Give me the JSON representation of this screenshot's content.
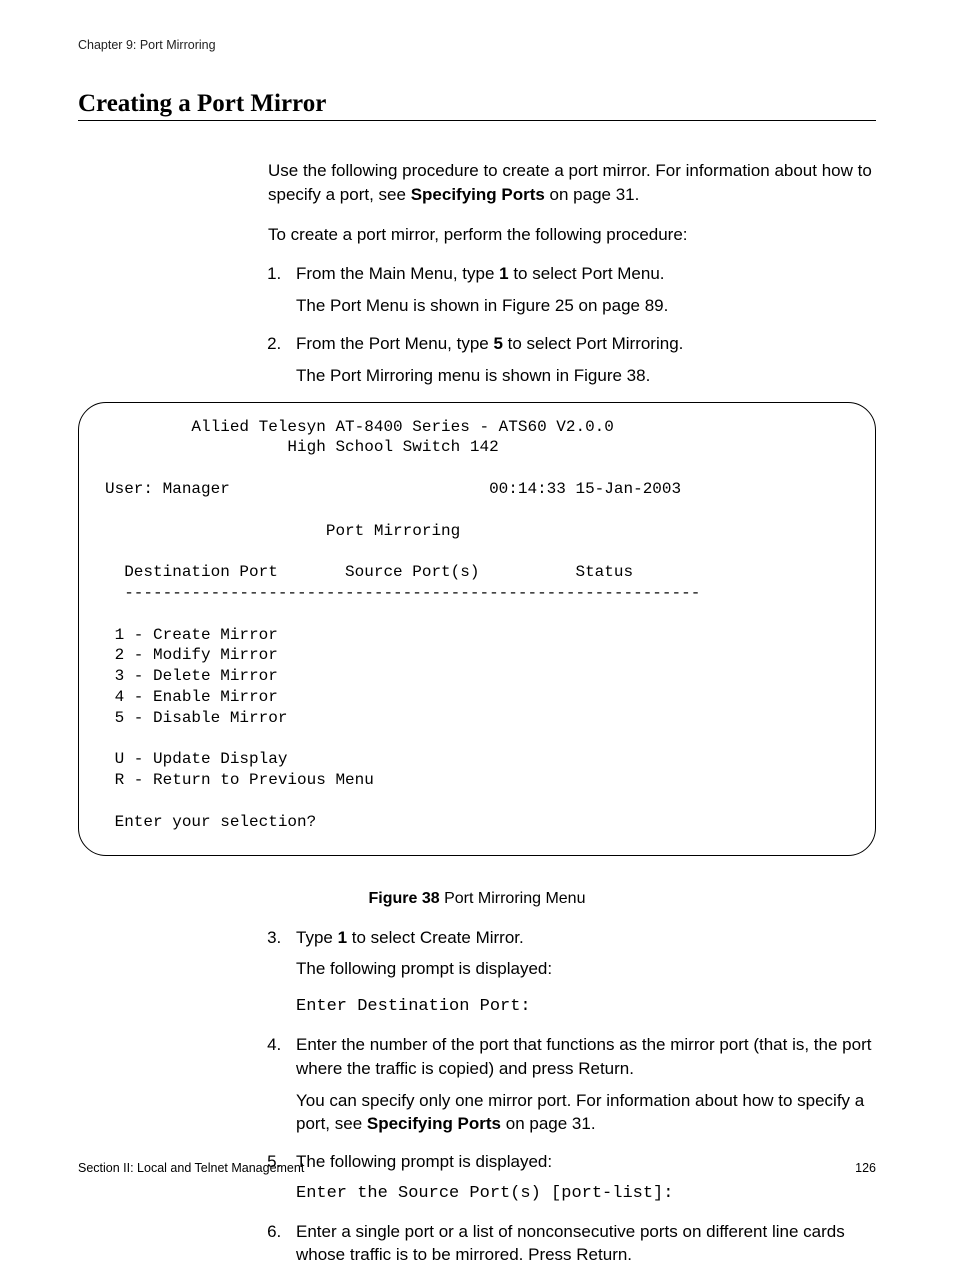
{
  "header": {
    "chapter": "Chapter 9: Port Mirroring"
  },
  "title": "Creating a Port Mirror",
  "intro1a": "Use the following procedure to create a port mirror. For information about how to specify a port, see ",
  "intro1b": "Specifying Ports",
  "intro1c": " on page 31.",
  "intro2": "To create a port mirror, perform the following procedure:",
  "step1a": "From the Main Menu, type ",
  "step1b": "1",
  "step1c": " to select Port Menu.",
  "step1sub": "The Port Menu is shown in Figure 25 on page 89.",
  "step2a": "From the Port Menu, type ",
  "step2b": "5",
  "step2c": " to select Port Mirroring.",
  "step2sub": "The Port Mirroring menu is shown in Figure 38.",
  "terminal": "         Allied Telesyn AT-8400 Series - ATS60 V2.0.0\n                   High School Switch 142\n\nUser: Manager                           00:14:33 15-Jan-2003\n\n                       Port Mirroring\n\n  Destination Port       Source Port(s)          Status\n  ------------------------------------------------------------\n\n 1 - Create Mirror\n 2 - Modify Mirror\n 3 - Delete Mirror\n 4 - Enable Mirror\n 5 - Disable Mirror\n\n U - Update Display\n R - Return to Previous Menu\n\n Enter your selection?",
  "figcap_a": "Figure 38",
  "figcap_b": "  Port Mirroring Menu",
  "step3a": "Type ",
  "step3b": "1",
  "step3c": " to select Create Mirror.",
  "step3sub1": "The following prompt is displayed:",
  "step3sub2": "Enter Destination Port:",
  "step4": "Enter the number of the port that functions as the mirror port (that is, the port where the traffic is copied) and press Return.",
  "step4sub_a": "You can specify only one mirror port. For information about how to specify a port, see ",
  "step4sub_b": "Specifying Ports",
  "step4sub_c": " on page 31.",
  "step5": "The following prompt is displayed:",
  "step5sub": "Enter the Source Port(s) [port-list]:",
  "step6": "Enter a single port or a list of nonconsecutive ports on different line cards whose traffic is to be mirrored. Press Return.",
  "footer": {
    "left": "Section II: Local and Telnet Management",
    "right": "126"
  }
}
